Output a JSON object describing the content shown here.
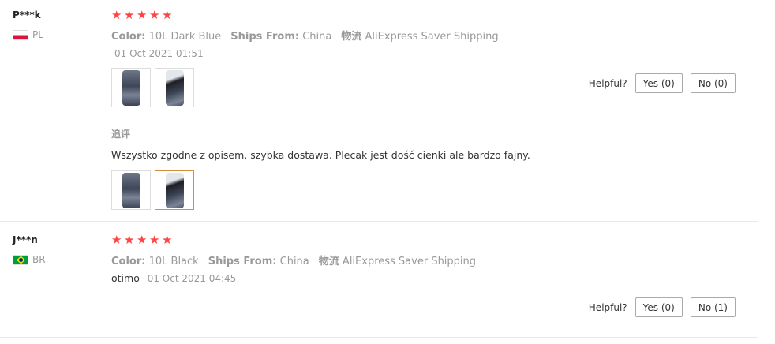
{
  "reviews": [
    {
      "user": "P***k",
      "country": "PL",
      "rating": 5,
      "color_label": "Color:",
      "color_value": "10L Dark Blue",
      "ships_label": "Ships From:",
      "ships_value": "China",
      "logistics_label": "物流",
      "logistics_value": "AliExpress Saver Shipping",
      "text": "",
      "date": "01 Oct 2021 01:51",
      "helpful_label": "Helpful?",
      "yes_label": "Yes (0)",
      "no_label": "No (0)",
      "followup": {
        "label": "追评",
        "text": "Wszystko zgodne z opisem, szybka dostawa. Plecak jest dość cienki ale bardzo fajny."
      }
    },
    {
      "user": "J***n",
      "country": "BR",
      "rating": 5,
      "color_label": "Color:",
      "color_value": "10L Black",
      "ships_label": "Ships From:",
      "ships_value": "China",
      "logistics_label": "物流",
      "logistics_value": "AliExpress Saver Shipping",
      "text": "otimo",
      "date": "01 Oct 2021 04:45",
      "helpful_label": "Helpful?",
      "yes_label": "Yes (0)",
      "no_label": "No (1)"
    }
  ],
  "colors": {
    "star": "#ff4747",
    "selected_thumb_border": "#d98c3a"
  }
}
